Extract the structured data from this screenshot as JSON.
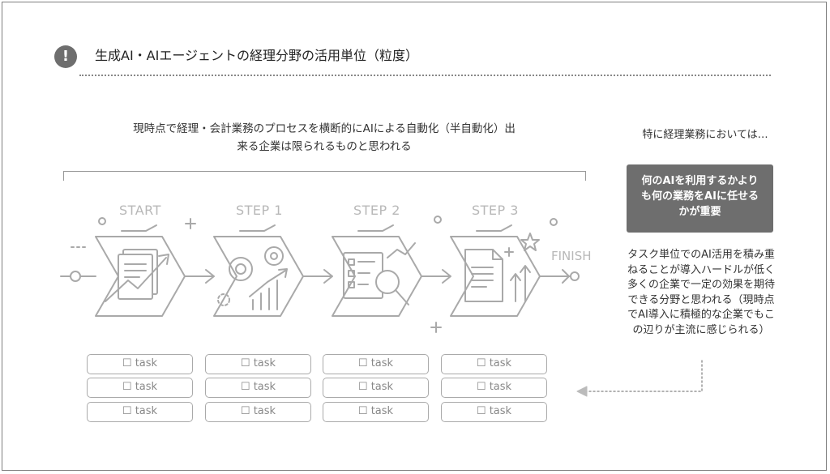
{
  "title": {
    "icon": "exclamation-icon",
    "icon_glyph": "!",
    "text": "生成AI・AIエージェントの経理分野の活用単位（粒度）"
  },
  "intro": {
    "line1": "現時点で経理・会計業務のプロセスを横断的にAIによる自動化（半自動化）出",
    "line2": "来る企業は限られるものと思われる"
  },
  "steps": [
    {
      "label": "START",
      "icon": "document-growth-icon"
    },
    {
      "label": "STEP 1",
      "icon": "gears-chart-icon"
    },
    {
      "label": "STEP 2",
      "icon": "checklist-magnifier-icon"
    },
    {
      "label": "STEP 3",
      "icon": "document-star-icon"
    }
  ],
  "finish_label": "FINISH",
  "task_label": "☐ task",
  "right": {
    "heading": "特に経理業務においては…",
    "highlight": "何のAIを利用するかよりも何の業務をAIに任せるかが重要",
    "body": "タスク単位でのAI活用を積み重ねることが導入ハードルが低く多くの企業で一定の効果を期待できる分野と思われる（現時点でAI導入に積極的な企業でもこの辺りが主流に感じられる）"
  },
  "colors": {
    "icon_gray": "#aaaaaa",
    "label_gray": "#b8b8b8",
    "highlight_bg": "#6e6e6e"
  }
}
